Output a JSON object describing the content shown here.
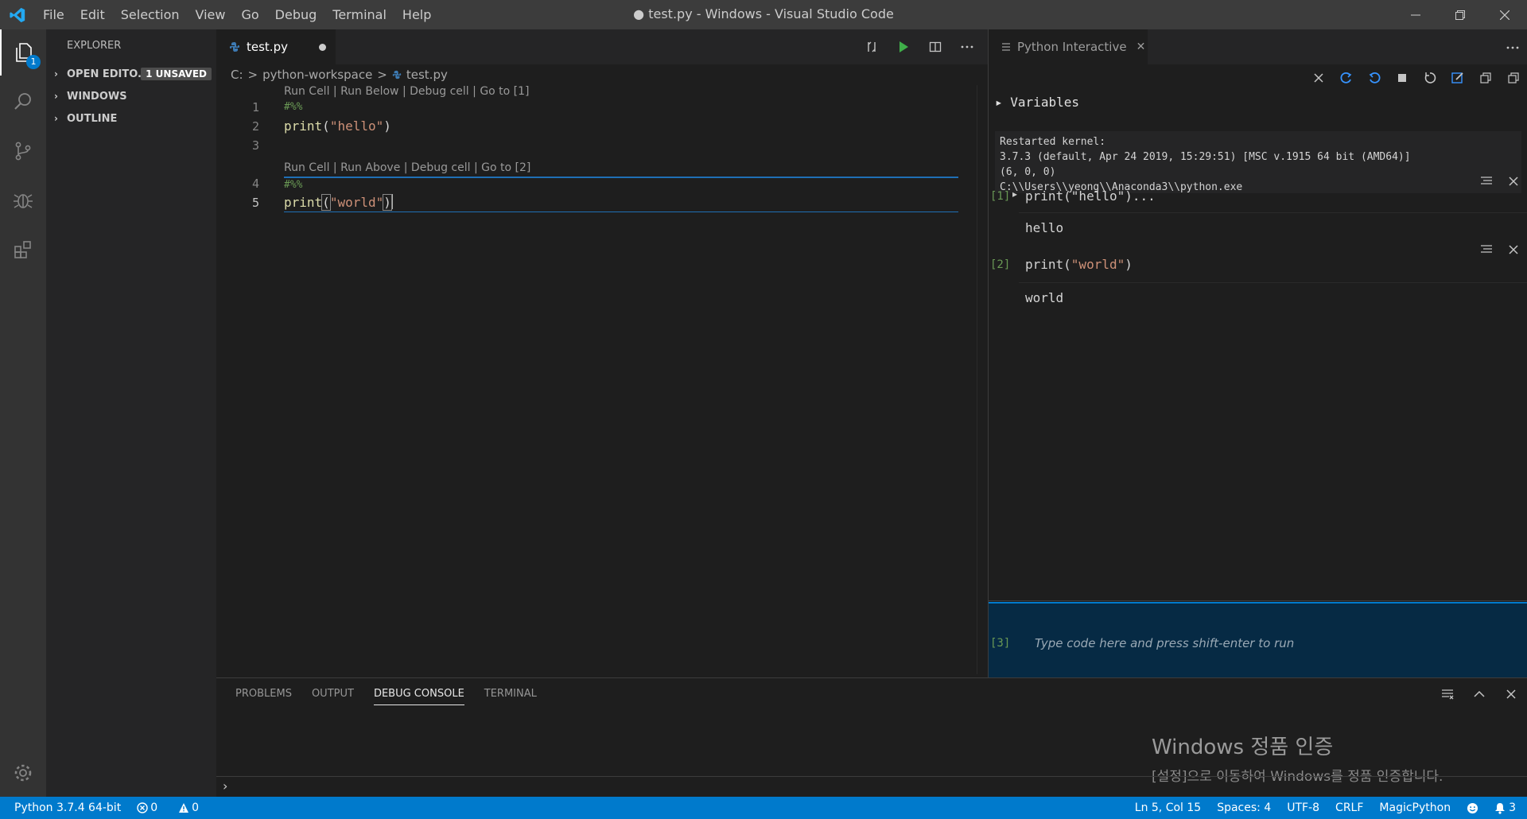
{
  "window": {
    "title": "● test.py - Windows - Visual Studio Code",
    "menu": [
      "File",
      "Edit",
      "Selection",
      "View",
      "Go",
      "Debug",
      "Terminal",
      "Help"
    ]
  },
  "activity": {
    "explorer_badge": "1"
  },
  "sidebar": {
    "title": "EXPLORER",
    "sections": [
      {
        "label": "OPEN EDITO...",
        "badge": "1 UNSAVED"
      },
      {
        "label": "WINDOWS"
      },
      {
        "label": "OUTLINE"
      }
    ]
  },
  "editor": {
    "tab": "test.py",
    "breadcrumb": [
      "C:",
      ">",
      "python-workspace",
      ">",
      "test.py"
    ],
    "codelens": [
      "Run Cell | Run Below | Debug cell | Go to [1]",
      "Run Cell | Run Above | Debug cell | Go to [2]"
    ],
    "lines": [
      {
        "num": "1",
        "comment": "#%%"
      },
      {
        "num": "2",
        "fn": "print",
        "open": "(",
        "str": "\"hello\"",
        "close": ")"
      },
      {
        "num": "3"
      },
      {
        "num": "4",
        "comment": "#%%"
      },
      {
        "num": "5",
        "fn": "print",
        "open": "(",
        "str": "\"world\"",
        "close": ")"
      }
    ]
  },
  "interactive": {
    "tab": "Python Interactive",
    "variables": "Variables",
    "kernel": "Restarted kernel:\n3.7.3 (default, Apr 24 2019, 15:29:51) [MSC v.1915 64 bit (AMD64)]\n(6, 0, 0)\nC:\\\\Users\\\\yeong\\\\Anaconda3\\\\python.exe",
    "cells": [
      {
        "count": "[1]",
        "source": "print(\"hello\")...",
        "output": "hello"
      },
      {
        "count": "[2]",
        "source": "print(\"world\")",
        "output": "world"
      }
    ],
    "input": {
      "count": "[3]",
      "placeholder": "Type code here and press shift-enter to run"
    }
  },
  "panel": {
    "tabs": [
      "PROBLEMS",
      "OUTPUT",
      "DEBUG CONSOLE",
      "TERMINAL"
    ],
    "active_tab": "DEBUG CONSOLE",
    "prompt": "›",
    "activation_title": "Windows 정품 인증",
    "activation_subtitle": "[설정]으로 이동하여 Windows를 정품 인증합니다."
  },
  "status": {
    "python": "Python 3.7.4 64-bit",
    "errors": "0",
    "warnings": "0",
    "position": "Ln 5, Col 15",
    "spaces": "Spaces: 4",
    "encoding": "UTF-8",
    "eol": "CRLF",
    "language": "MagicPython",
    "notifications": "3"
  },
  "colors": {
    "accent": "#007acc",
    "activity_bar": "#333333",
    "sidebar": "#252526",
    "editor": "#1e1e1e",
    "input_cell": "#062a44"
  }
}
